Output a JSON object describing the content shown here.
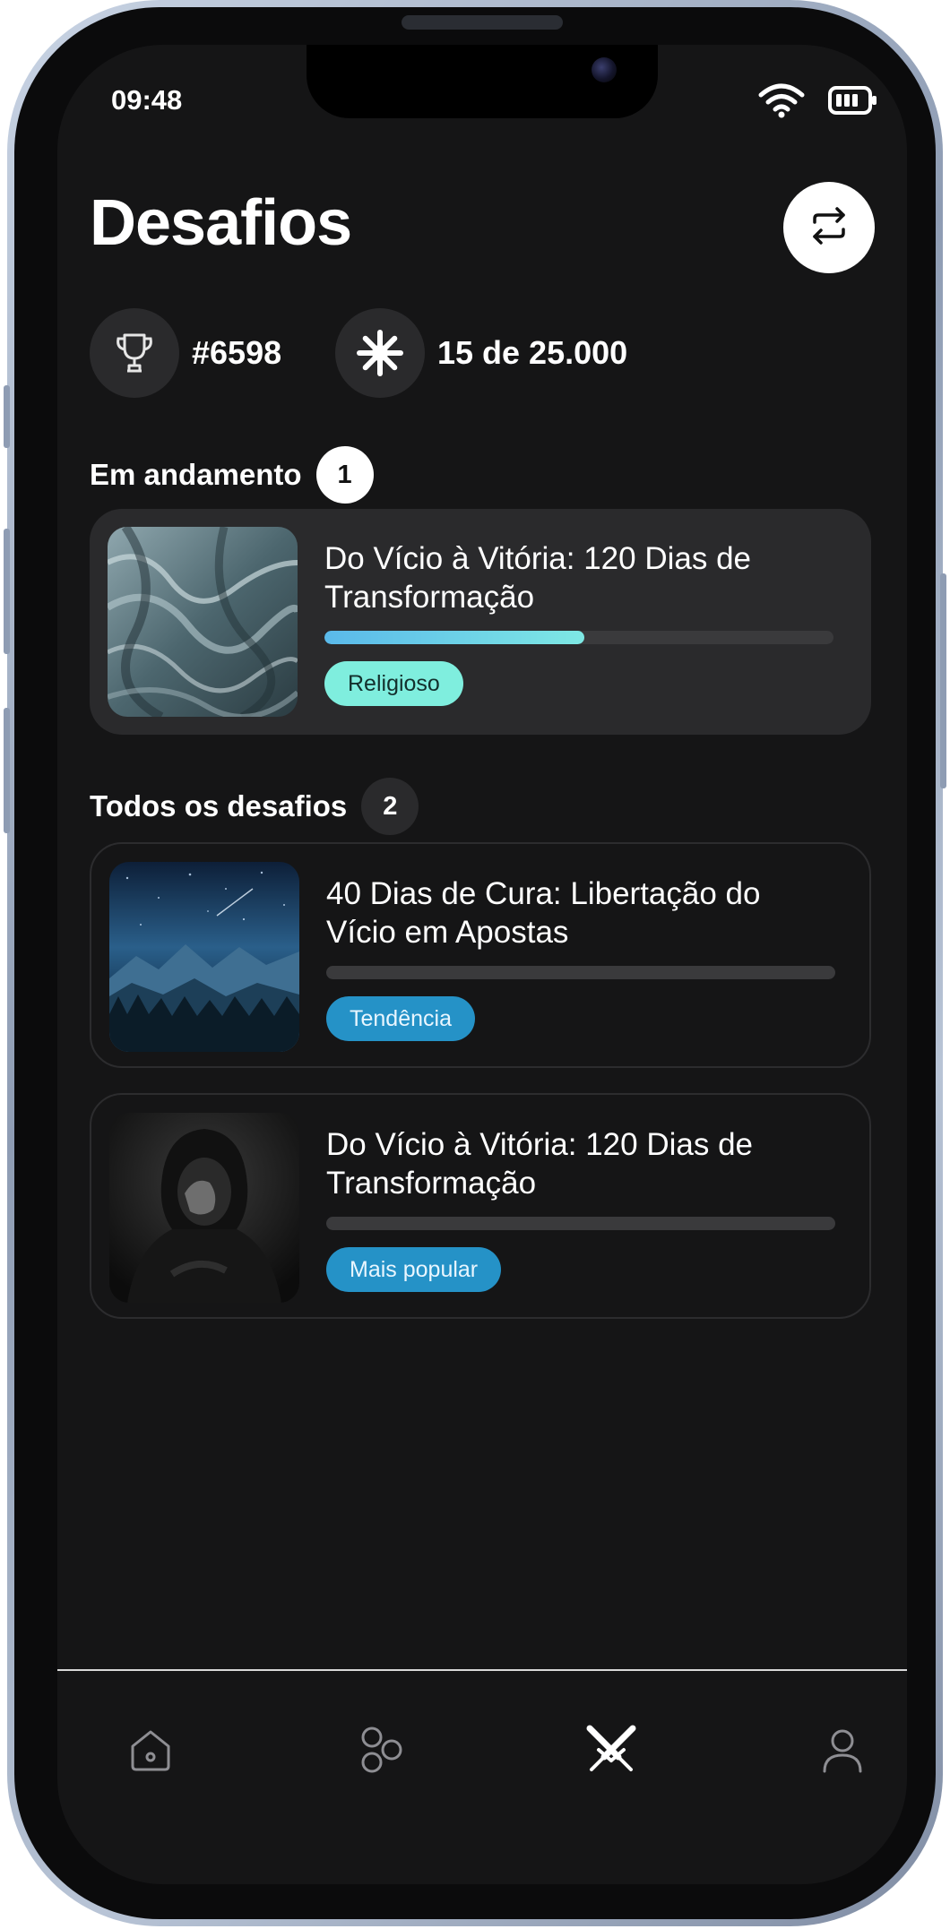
{
  "status_bar": {
    "time": "09:48"
  },
  "header": {
    "title": "Desafios"
  },
  "stats": {
    "rank": "#6598",
    "progress": "15 de 25.000"
  },
  "in_progress": {
    "title": "Em andamento",
    "count": "1",
    "challenges": [
      {
        "title": "Do Vício à Vitória: 120 Dias de Transformação",
        "tag": "Religioso",
        "progress": 0.51
      }
    ]
  },
  "all_challenges": {
    "title": "Todos os desafios",
    "count": "2",
    "challenges": [
      {
        "title": "40 Dias de Cura: Libertação do Vício em Apostas",
        "tag": "Tendência",
        "progress": 0
      },
      {
        "title": "Do Vício à Vitória: 120 Dias de Transformação",
        "tag": "Mais popular",
        "progress": 0
      }
    ]
  },
  "tab_bar": {
    "tabs": [
      "home-icon",
      "community-icon",
      "challenges-icon",
      "profile-icon"
    ],
    "active": "challenges-icon"
  },
  "colors": {
    "background": "#151516",
    "accent_mint": "#7feede",
    "accent_blue": "#2592c7",
    "progress": "#5ab9ea"
  }
}
